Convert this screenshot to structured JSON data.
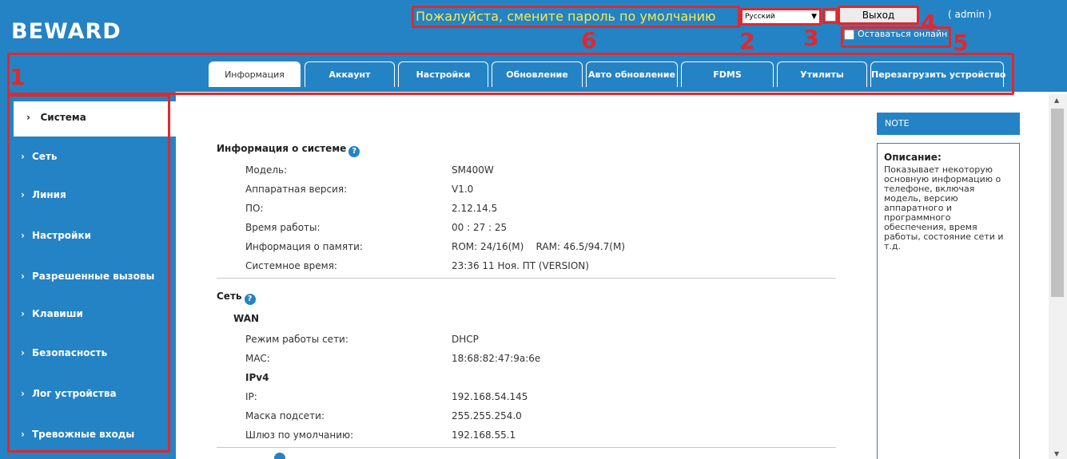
{
  "header": {
    "logo": "BEWARD",
    "warning": "Пожалуйста, смените пароль по умолчанию",
    "language": "Русский",
    "logout_label": "Выход",
    "user": "( admin )",
    "stay_online_label": "Оставаться онлайн"
  },
  "annotations": {
    "n1": "1",
    "n2": "2",
    "n3": "3",
    "n4": "4",
    "n5": "5",
    "n6": "6"
  },
  "tabs": [
    {
      "label": "Информация"
    },
    {
      "label": "Аккаунт"
    },
    {
      "label": "Настройки"
    },
    {
      "label": "Обновление"
    },
    {
      "label": "Авто обновление"
    },
    {
      "label": "FDMS"
    },
    {
      "label": "Утилиты"
    },
    {
      "label": "Перезагрузить устройство"
    }
  ],
  "sidebar": {
    "active": "Система",
    "items": [
      {
        "label": "Сеть"
      },
      {
        "label": "Линия"
      },
      {
        "label": "Настройки"
      },
      {
        "label": "Разрешенные вызовы"
      },
      {
        "label": "Клавиши"
      },
      {
        "label": "Безопасность"
      },
      {
        "label": "Лог устройства"
      },
      {
        "label": "Тревожные входы"
      }
    ]
  },
  "system_info": {
    "title": "Информация о системе",
    "model_label": "Модель:",
    "model": "SM400W",
    "hw_label": "Аппаратная версия:",
    "hw": "V1.0",
    "fw_label": "ПО:",
    "fw": "2.12.14.5",
    "uptime_label": "Время работы:",
    "uptime": "00 : 27 : 25",
    "mem_label": "Информация о памяти:",
    "mem": "ROM: 24/16(M)    RAM: 46.5/94.7(M)",
    "time_label": "Системное время:",
    "time": "23:36 11 Ноя. ПТ (VERSION)"
  },
  "network": {
    "title": "Сеть",
    "wan": "WAN",
    "mode_label": "Режим работы сети:",
    "mode": "DHCP",
    "mac_label": "MAC:",
    "mac": "18:68:82:47:9a:6e",
    "ipv4": "IPv4",
    "ip_label": "IP:",
    "ip": "192.168.54.145",
    "mask_label": "Маска подсети:",
    "mask": "255.255.254.0",
    "gw_label": "Шлюз по умолчанию:",
    "gw": "192.168.55.1"
  },
  "note": {
    "header": "NOTE",
    "title": "Описание:",
    "text": "Показывает некоторую основную информацию о телефоне, включая модель, версию аппаратного и программного обеспечения, время работы, состояние сети и т.д."
  },
  "icons": {
    "help": "question-icon",
    "dropdown": "chevron-down-icon"
  },
  "colors": {
    "brand": "#2483c4",
    "warning": "#ffe94a",
    "annotation": "#e0282d"
  }
}
